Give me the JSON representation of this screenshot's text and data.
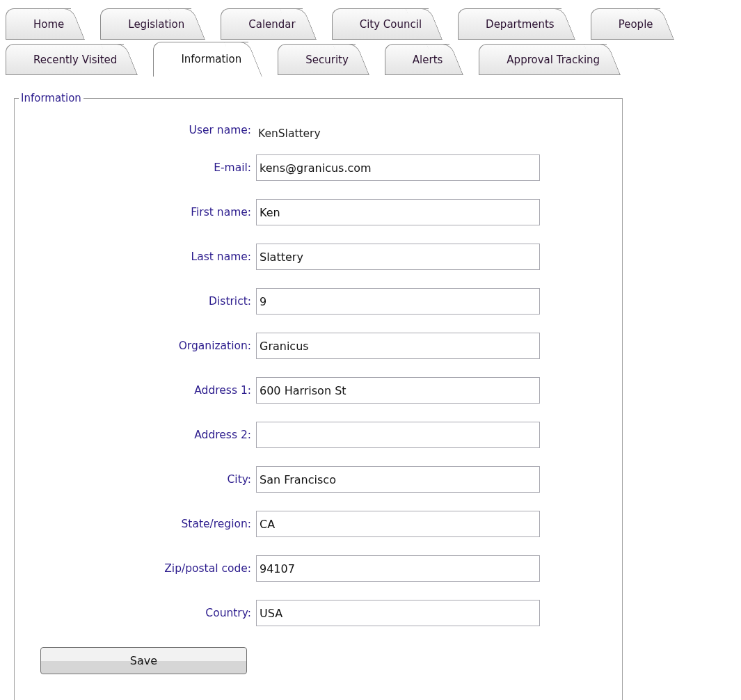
{
  "tab_rows": [
    {
      "tabs": [
        {
          "label": "Home",
          "selected": false
        },
        {
          "label": "Legislation",
          "selected": false
        },
        {
          "label": "Calendar",
          "selected": false
        },
        {
          "label": "City Council",
          "selected": false
        },
        {
          "label": "Departments",
          "selected": false
        },
        {
          "label": "People",
          "selected": false
        }
      ]
    },
    {
      "tabs": [
        {
          "label": "Recently Visited",
          "selected": false
        },
        {
          "label": "Information",
          "selected": true
        },
        {
          "label": "Security",
          "selected": false
        },
        {
          "label": "Alerts",
          "selected": false
        },
        {
          "label": "Approval Tracking",
          "selected": false
        }
      ]
    }
  ],
  "section": {
    "legend": "Information",
    "fields": [
      {
        "kind": "static",
        "label": "User name:",
        "value": "KenSlattery"
      },
      {
        "kind": "input",
        "label": "E-mail:",
        "value": "kens@granicus.com"
      },
      {
        "kind": "input",
        "label": "First name:",
        "value": "Ken"
      },
      {
        "kind": "input",
        "label": "Last name:",
        "value": "Slattery"
      },
      {
        "kind": "input",
        "label": "District:",
        "value": "9"
      },
      {
        "kind": "input",
        "label": "Organization:",
        "value": "Granicus"
      },
      {
        "kind": "input",
        "label": "Address 1:",
        "value": "600 Harrison St"
      },
      {
        "kind": "input",
        "label": "Address 2:"
      },
      {
        "kind": "input",
        "label": "City:",
        "value": "San Francisco"
      },
      {
        "kind": "input",
        "label": "State/region:",
        "value": "CA"
      },
      {
        "kind": "input",
        "label": "Zip/postal code:",
        "value": "94107"
      },
      {
        "kind": "input",
        "label": "Country:",
        "value": "USA"
      }
    ],
    "button": "Save"
  }
}
